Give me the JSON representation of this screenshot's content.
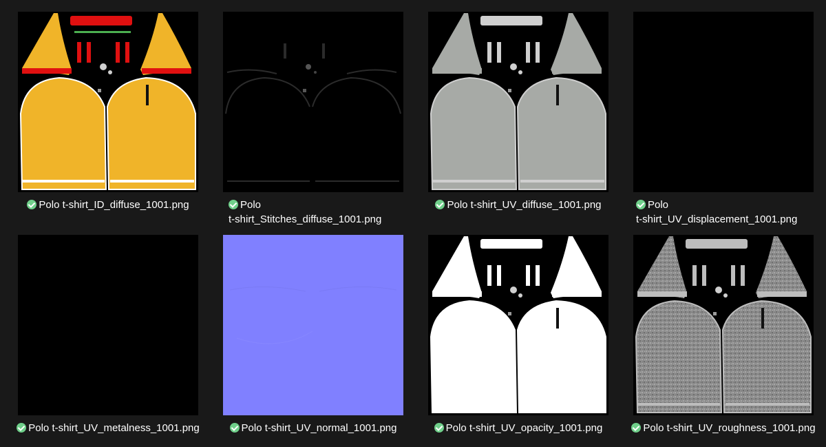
{
  "window": {
    "background": "#191919"
  },
  "files": [
    {
      "name": "Polo t-shirt_ID_diffuse_1001.png",
      "line1": "Polo t-shirt_ID_diffuse_1001.png",
      "line2": "",
      "status_icon": "synced-check-icon",
      "preview": "id_map"
    },
    {
      "name": "Polo t-shirt_Stitches_diffuse_1001.png",
      "line1": "Polo",
      "line2": "t-shirt_Stitches_diffuse_1001.png",
      "status_icon": "synced-check-icon",
      "preview": "stitches_map"
    },
    {
      "name": "Polo t-shirt_UV_diffuse_1001.png",
      "line1": "Polo t-shirt_UV_diffuse_1001.png",
      "line2": "",
      "status_icon": "synced-check-icon",
      "preview": "gray_diffuse_map"
    },
    {
      "name": "Polo t-shirt_UV_displacement_1001.png",
      "line1": "Polo",
      "line2": "t-shirt_UV_displacement_1001.png",
      "status_icon": "synced-check-icon",
      "preview": "black_map"
    },
    {
      "name": "Polo t-shirt_UV_metalness_1001.png",
      "line1": "Polo t-shirt_UV_metalness_1001.png",
      "line2": "",
      "status_icon": "synced-check-icon",
      "preview": "black_map"
    },
    {
      "name": "Polo t-shirt_UV_normal_1001.png",
      "line1": "Polo t-shirt_UV_normal_1001.png",
      "line2": "",
      "status_icon": "synced-check-icon",
      "preview": "normal_map"
    },
    {
      "name": "Polo t-shirt_UV_opacity_1001.png",
      "line1": "Polo t-shirt_UV_opacity_1001.png",
      "line2": "",
      "status_icon": "synced-check-icon",
      "preview": "opacity_map"
    },
    {
      "name": "Polo t-shirt_UV_roughness_1001.png",
      "line1": "Polo t-shirt_UV_roughness_1001.png",
      "line2": "",
      "status_icon": "synced-check-icon",
      "preview": "roughness_map"
    }
  ],
  "colors": {
    "id_yellow": "#f0b429",
    "id_red": "#e01010",
    "id_green": "#4caf50",
    "gray_diffuse": "#a7aaa6",
    "normal_blue": "#8080ff",
    "opacity_white": "#ffffff",
    "roughness_gray": "#8a8a8a",
    "stitch_gray": "#2b2b2b",
    "status_green": "#6fcf8a"
  }
}
